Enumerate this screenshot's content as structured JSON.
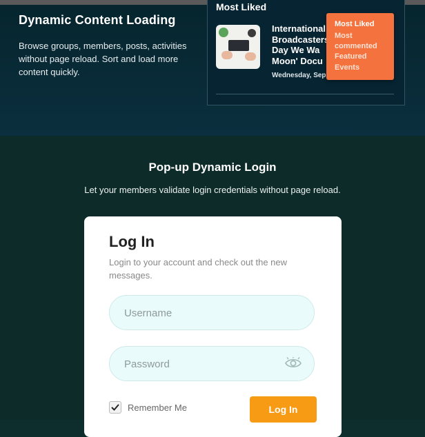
{
  "dynamic_content": {
    "title": "Dynamic Content Loading",
    "description": "Browse groups, members, posts, activities without page reload. Sort and load more content quickly."
  },
  "most_liked_widget": {
    "heading": "Most Liked",
    "article_title": "International\nBroadcasters\nDay We Wa\nMoon' Docu",
    "article_date": "Wednesday, Sep",
    "dropdown_options": [
      "Most Liked",
      "Most commented",
      "Featured",
      "Events"
    ],
    "selected_option": "Most Liked"
  },
  "popup_login_section": {
    "title": "Pop-up Dynamic Login",
    "description": "Let your members validate login credentials without page reload."
  },
  "login_form": {
    "title": "Log In",
    "subtitle": "Login to your account and check out the new messages.",
    "username_placeholder": "Username",
    "password_placeholder": "Password",
    "remember_label": "Remember Me",
    "remember_checked": true,
    "submit_label": "Log In"
  },
  "colors": {
    "accent_orange": "#f79a14",
    "dropdown_orange": "#f4723e",
    "field_bg": "#e9fbfb"
  },
  "icons": [
    "eye-icon",
    "check-icon"
  ]
}
